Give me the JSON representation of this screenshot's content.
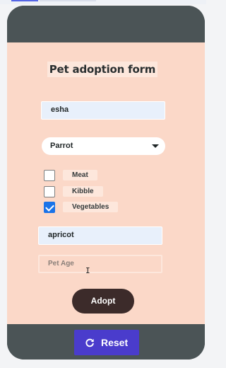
{
  "colors": {
    "frame": "#4b5456",
    "content_bg": "#fbd8c8",
    "label_bg": "#fde7dc",
    "input_bg": "#e8f0fb",
    "checkbox_checked": "#1a73e8",
    "adopt_button": "#3c2b2a",
    "reset_button": "#4a3ccc"
  },
  "form": {
    "title": "Pet adoption form",
    "name_value": "esha",
    "pet_type_selected": "Parrot",
    "food_options": [
      {
        "label": "Meat",
        "checked": false
      },
      {
        "label": "Kibble",
        "checked": false
      },
      {
        "label": "Vegetables",
        "checked": true
      }
    ],
    "color_value": "apricot",
    "age_placeholder": "Pet Age",
    "adopt_label": "Adopt"
  },
  "footer": {
    "reset_label": "Reset",
    "reset_icon": "refresh-icon"
  }
}
